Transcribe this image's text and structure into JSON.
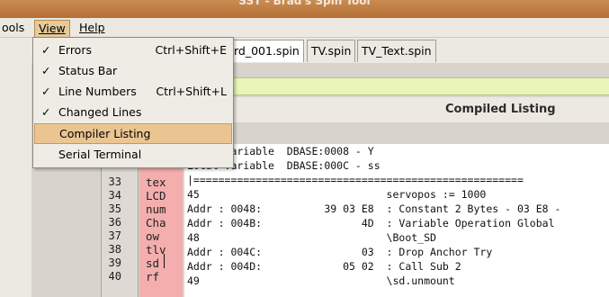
{
  "title": "SST - Brad's Spin Tool",
  "menu": {
    "tools": "ools",
    "view": "View",
    "help": "Help"
  },
  "view_menu": [
    {
      "check": "✓",
      "label": "Errors",
      "accel": "Ctrl+Shift+E"
    },
    {
      "check": "✓",
      "label": "Status Bar",
      "accel": ""
    },
    {
      "check": "✓",
      "label": "Line Numbers",
      "accel": "Ctrl+Shift+L"
    },
    {
      "check": "✓",
      "label": "Changed Lines",
      "accel": ""
    },
    {
      "check": "",
      "label": "Compiler Listing",
      "accel": ""
    },
    {
      "check": "",
      "label": "Serial Terminal",
      "accel": ""
    }
  ],
  "tabs": [
    "rd_001.spin",
    "TV.spin",
    "TV_Text.spin"
  ],
  "header_title": "Compiled Listing",
  "line_numbers": [
    "33",
    "34",
    "35",
    "36",
    "37",
    "38",
    "39",
    "40"
  ],
  "side_text": [
    "tex",
    "LCD",
    "num",
    "Cha",
    "ow",
    "tlv",
    "sd",
    "rf"
  ],
  "listing": [
    "Local Variable  DBASE:0008 - Y",
    "Local Variable  DBASE:000C - ss",
    "|=====================================================",
    "45                              servopos := 1000",
    "Addr : 0048:          39 03 E8  : Constant 2 Bytes - 03 E8 -",
    "Addr : 004B:                4D  : Variable Operation Global",
    "48                              \\Boot_SD",
    "Addr : 004C:                03  : Drop Anchor Try",
    "Addr : 004D:             05 02  : Call Sub 2",
    "49                              \\sd.unmount"
  ]
}
